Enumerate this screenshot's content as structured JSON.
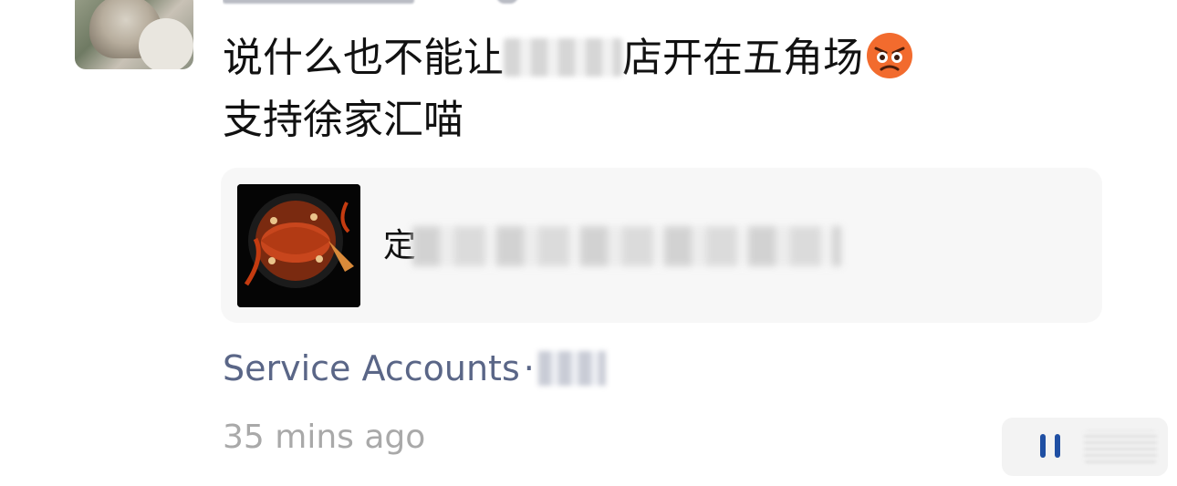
{
  "post": {
    "text_line1_before": "说什么也不能让",
    "text_line1_after": "店开在五角场",
    "text_line2": "支持徐家汇喵"
  },
  "card": {
    "title_visible": "定"
  },
  "source": {
    "label": "Service Accounts",
    "separator": "·"
  },
  "timestamp": "35 mins ago",
  "icons": {
    "emoji": "angry-face-icon",
    "more": "more-icon"
  },
  "colors": {
    "source_text": "#5a6687",
    "time_text": "#a9a9a9",
    "card_bg": "#f7f7f7",
    "emoji": "#f26b2e"
  }
}
